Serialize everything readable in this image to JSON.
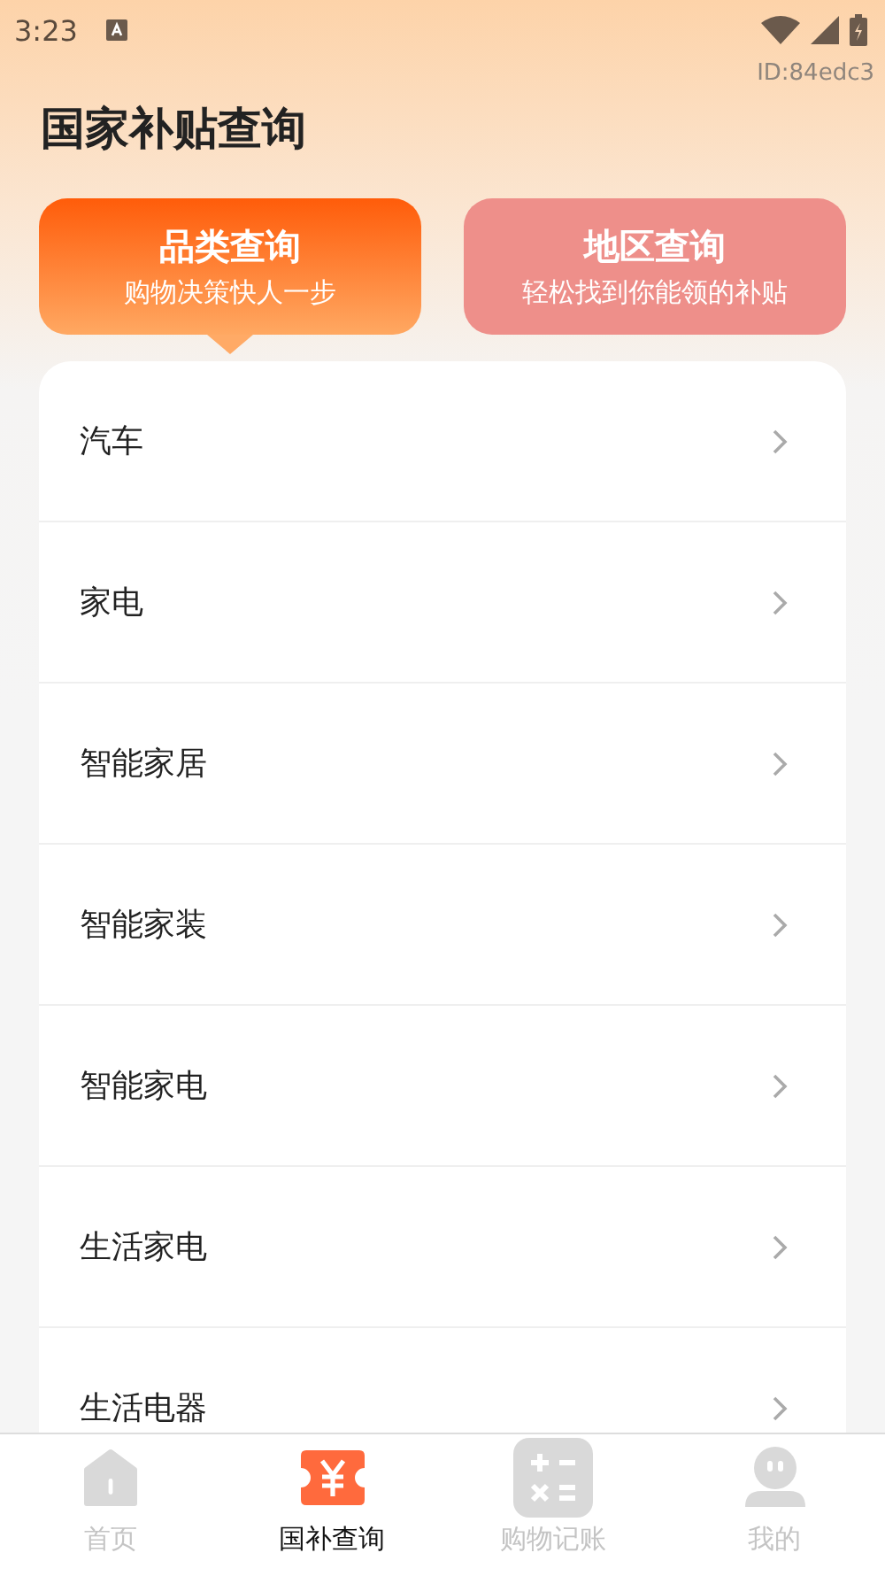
{
  "status_bar": {
    "time": "3:23"
  },
  "id_label": "ID:84edc3",
  "title": "国家补贴查询",
  "query_tabs": [
    {
      "label": "品类查询",
      "subtitle": "购物决策快人一步",
      "selected": true
    },
    {
      "label": "地区查询",
      "subtitle": "轻松找到你能领的补贴",
      "selected": false
    }
  ],
  "categories": [
    {
      "label": "汽车"
    },
    {
      "label": "家电"
    },
    {
      "label": "智能家居"
    },
    {
      "label": "智能家装"
    },
    {
      "label": "智能家电"
    },
    {
      "label": "生活家电"
    },
    {
      "label": "生活电器"
    }
  ],
  "bottom_nav": [
    {
      "label": "首页",
      "kind": "home",
      "selected": false
    },
    {
      "label": "国补查询",
      "kind": "ticket",
      "selected": true
    },
    {
      "label": "购物记账",
      "kind": "calculator",
      "selected": false
    },
    {
      "label": "我的",
      "kind": "person",
      "selected": false
    }
  ]
}
